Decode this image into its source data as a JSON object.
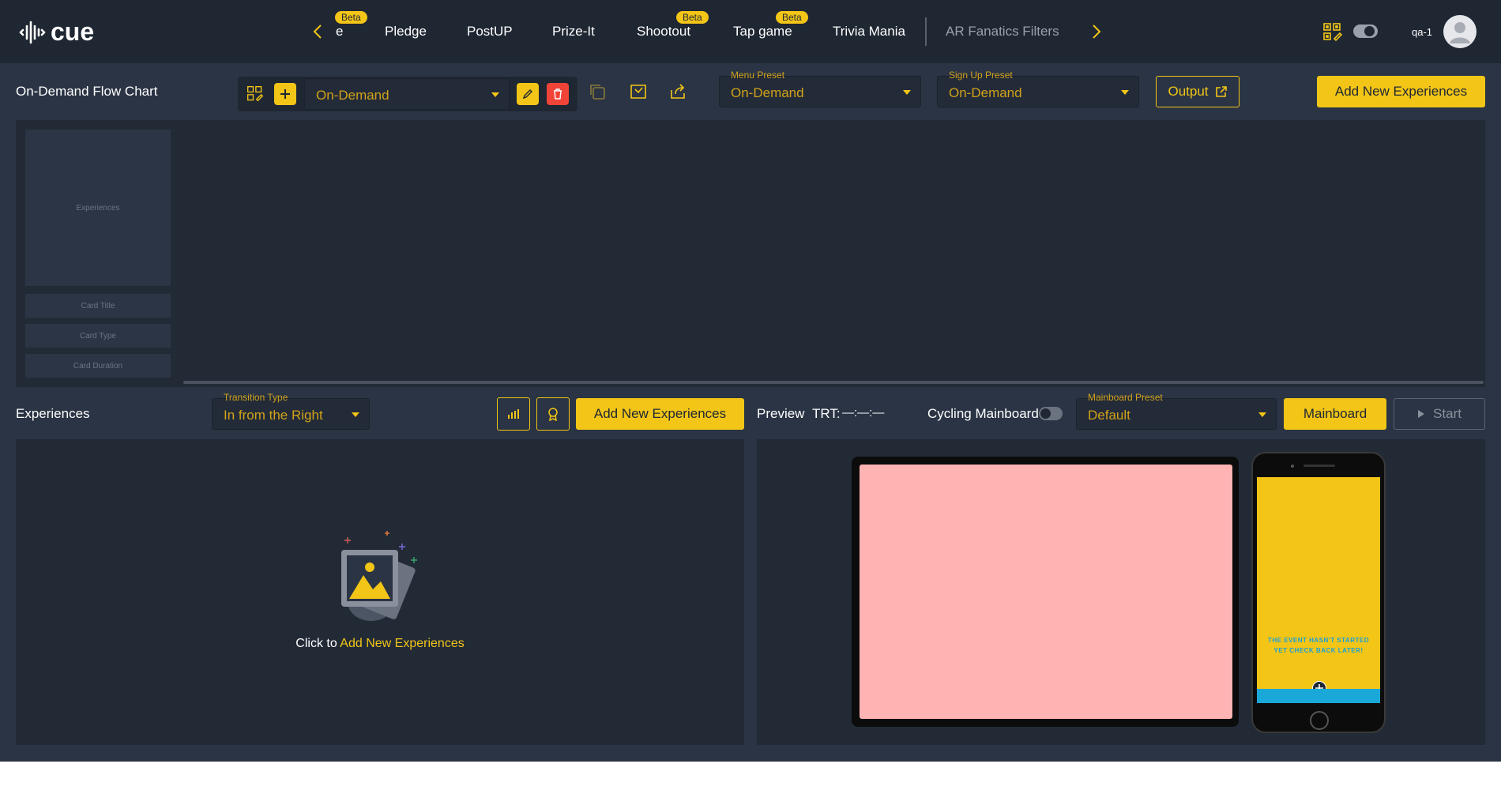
{
  "app": {
    "logo_text": "cue",
    "username": "qa-1"
  },
  "nav": {
    "tabs": [
      {
        "label": "e",
        "beta": "Beta"
      },
      {
        "label": "Pledge"
      },
      {
        "label": "PostUP"
      },
      {
        "label": "Prize-It"
      },
      {
        "label": "Shootout",
        "beta": "Beta"
      },
      {
        "label": "Tap game",
        "beta": "Beta"
      },
      {
        "label": "Trivia Mania"
      },
      {
        "label": "AR Fanatics Filters"
      }
    ]
  },
  "toolbar": {
    "page_title": "On-Demand Flow Chart",
    "flow_select_value": "On-Demand",
    "menu_preset_label": "Menu Preset",
    "menu_preset_value": "On-Demand",
    "signup_preset_label": "Sign Up Preset",
    "signup_preset_value": "On-Demand",
    "output_label": "Output",
    "add_new_label": "Add New Experiences"
  },
  "flow": {
    "card_label": "Experiences",
    "card_title": "Card Title",
    "card_type": "Card Type",
    "card_duration": "Card Duration"
  },
  "experiences": {
    "title": "Experiences",
    "transition_label": "Transition Type",
    "transition_value": "In from the Right",
    "add_new_label": "Add New Experiences",
    "empty_prefix": "Click to",
    "empty_link": "Add New Experiences"
  },
  "preview": {
    "title": "Preview",
    "trt_label": "TRT:",
    "trt_value": "—:—:—",
    "cycling_label": "Cycling Mainboard",
    "mainboard_preset_label": "Mainboard Preset",
    "mainboard_preset_value": "Default",
    "mainboard_label": "Mainboard",
    "start_label": "Start",
    "phone_message": "THE EVENT HASN'T STARTED YET CHECK BACK LATER!"
  },
  "colors": {
    "accent": "#f2c517",
    "bg": "#2a3444",
    "panel": "#222a36",
    "danger": "#f04438"
  }
}
